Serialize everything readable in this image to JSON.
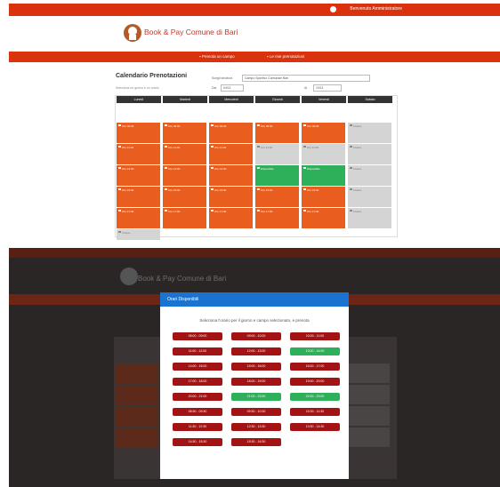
{
  "top": {
    "topbar": {
      "user_label": "Benvenuto Amministratore"
    },
    "brand": {
      "name": "Book & Pay Comune di Bari",
      "subtitle": ""
    },
    "navbar": {
      "items": [
        {
          "label": "Prenota un campo",
          "icon": "calendar-icon"
        },
        {
          "label": "Le mie prenotazioni",
          "icon": "list-icon"
        }
      ]
    },
    "calendar": {
      "title": "Calendario Prenotazioni",
      "subtitle": "Seleziona un giorno e un orario",
      "filter_struttura_label": "Scegli struttura",
      "filter_struttura_value": "Campo Sportivo Comunale Bari",
      "filter_data_label": "Dal",
      "filter_data_value": "04/11",
      "filter_data2_label": "Al",
      "filter_data2_value": "10/11",
      "days": [
        "Lunedì",
        "Martedì",
        "Mercoledì",
        "Giovedì",
        "Venerdì",
        "Sabato"
      ],
      "columns": [
        {
          "slots": [
            {
              "kind": "orange",
              "text": "Ore 09:00"
            },
            {
              "kind": "orange",
              "text": "Ore 11:00"
            },
            {
              "kind": "orange",
              "text": "Ore 13:00"
            },
            {
              "kind": "orange",
              "text": "Ore 15:00"
            },
            {
              "kind": "orange",
              "text": "Ore 17:00"
            },
            {
              "kind": "gray",
              "text": "Chiuso"
            }
          ]
        },
        {
          "slots": [
            {
              "kind": "orange",
              "text": "Ore 09:00"
            },
            {
              "kind": "orange",
              "text": "Ore 11:00"
            },
            {
              "kind": "orange",
              "text": "Ore 13:00"
            },
            {
              "kind": "orange",
              "text": "Ore 15:00"
            },
            {
              "kind": "orange",
              "text": "Ore 17:00"
            }
          ]
        },
        {
          "slots": [
            {
              "kind": "orange",
              "text": "Ore 09:00"
            },
            {
              "kind": "orange",
              "text": "Ore 11:00"
            },
            {
              "kind": "orange",
              "text": "Ore 13:00"
            },
            {
              "kind": "orange",
              "text": "Ore 15:00"
            },
            {
              "kind": "orange",
              "text": "Ore 17:00"
            }
          ]
        },
        {
          "slots": [
            {
              "kind": "orange",
              "text": "Ore 09:00"
            },
            {
              "kind": "gray",
              "text": "Ore 11:00"
            },
            {
              "kind": "green",
              "text": "Disponibile"
            },
            {
              "kind": "orange",
              "text": "Ore 15:00"
            },
            {
              "kind": "orange",
              "text": "Ore 17:00"
            }
          ]
        },
        {
          "slots": [
            {
              "kind": "orange",
              "text": "Ore 09:00"
            },
            {
              "kind": "gray",
              "text": "Ore 11:00"
            },
            {
              "kind": "green",
              "text": "Disponibile"
            },
            {
              "kind": "orange",
              "text": "Ore 15:00"
            },
            {
              "kind": "orange",
              "text": "Ore 17:00"
            }
          ]
        },
        {
          "slots": [
            {
              "kind": "gray",
              "text": "Chiuso"
            },
            {
              "kind": "gray",
              "text": "Chiuso"
            },
            {
              "kind": "gray",
              "text": "Chiuso"
            },
            {
              "kind": "gray",
              "text": "Chiuso"
            },
            {
              "kind": "gray",
              "text": "Chiuso"
            }
          ]
        }
      ]
    }
  },
  "modal": {
    "title": "Orari Disponibili",
    "description": "Seleziona l'orario per il giorno e campo selezionato, e prenota",
    "times": [
      {
        "label": "08:00 - 09:00",
        "free": false
      },
      {
        "label": "09:00 - 10:00",
        "free": false
      },
      {
        "label": "10:00 - 11:00",
        "free": false
      },
      {
        "label": "11:00 - 12:00",
        "free": false
      },
      {
        "label": "12:00 - 13:00",
        "free": false
      },
      {
        "label": "13:00 - 14:00",
        "free": true
      },
      {
        "label": "14:00 - 15:00",
        "free": false
      },
      {
        "label": "15:00 - 16:00",
        "free": false
      },
      {
        "label": "16:00 - 17:00",
        "free": false
      },
      {
        "label": "17:00 - 18:00",
        "free": false
      },
      {
        "label": "18:00 - 19:00",
        "free": false
      },
      {
        "label": "19:00 - 20:00",
        "free": false
      },
      {
        "label": "20:00 - 21:00",
        "free": false
      },
      {
        "label": "21:00 - 22:00",
        "free": true
      },
      {
        "label": "22:00 - 23:00",
        "free": true
      },
      {
        "label": "08:30 - 09:30",
        "free": false
      },
      {
        "label": "09:30 - 10:30",
        "free": false
      },
      {
        "label": "10:30 - 11:30",
        "free": false
      },
      {
        "label": "11:30 - 12:30",
        "free": false
      },
      {
        "label": "12:30 - 13:30",
        "free": false
      },
      {
        "label": "13:30 - 14:30",
        "free": false
      },
      {
        "label": "14:30 - 15:30",
        "free": false
      },
      {
        "label": "15:30 - 16:30",
        "free": false
      }
    ]
  },
  "colors": {
    "brand": "#d9320d",
    "slot": "#e95d1e",
    "free": "#2eaf5a",
    "busy": "#a31313",
    "modal_head": "#1a73d0"
  }
}
